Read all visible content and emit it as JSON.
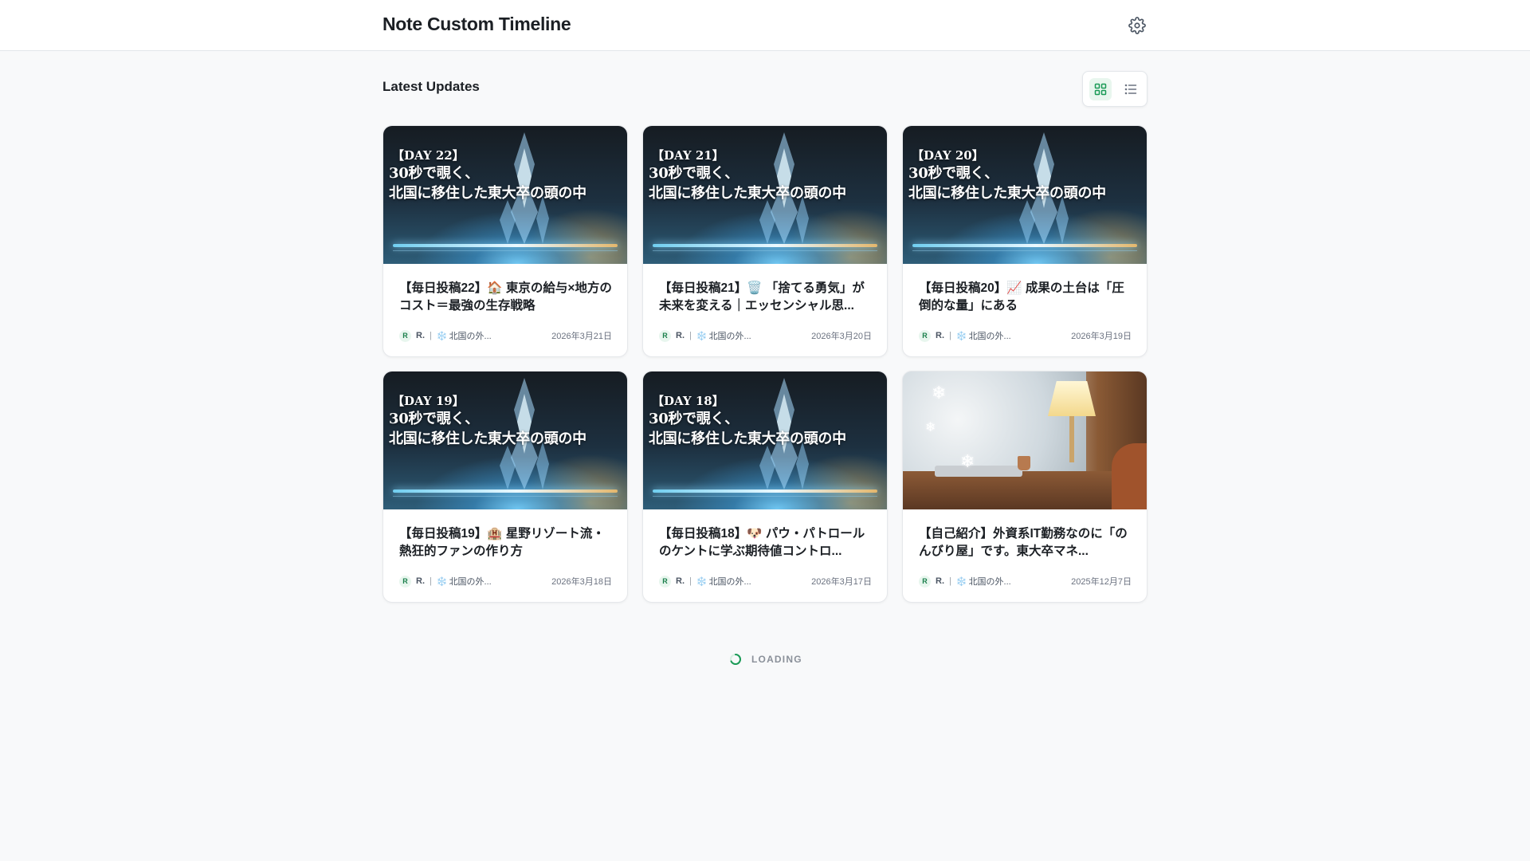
{
  "header": {
    "title": "Note Custom Timeline",
    "settings_icon": "gear-icon"
  },
  "section": {
    "title": "Latest Updates",
    "view_toggle": {
      "active": "grid",
      "grid_icon": "grid-icon",
      "list_icon": "list-icon"
    }
  },
  "colors": {
    "accent": "#1a7f4b",
    "accent_bg": "#e8f6ee",
    "background": "#f8f9fa"
  },
  "cards": [
    {
      "thumb_type": "day",
      "thumb_day": "【DAY 22】",
      "thumb_line1": "30秒で覗く、",
      "thumb_line2": "北国に移住した東大卒の頭の中",
      "title": "【毎日投稿22】🏠 東京の給与×地方のコスト＝最強の生存戦略",
      "avatar": "R",
      "author": "R.",
      "sep": "|",
      "magazine_icon": "❄️",
      "magazine": "北国の外...",
      "date": "2026年3月21日"
    },
    {
      "thumb_type": "day",
      "thumb_day": "【DAY 21】",
      "thumb_line1": "30秒で覗く、",
      "thumb_line2": "北国に移住した東大卒の頭の中",
      "title": "【毎日投稿21】🗑️ 「捨てる勇気」が未来を変える｜エッセンシャル思...",
      "avatar": "R",
      "author": "R.",
      "sep": "|",
      "magazine_icon": "❄️",
      "magazine": "北国の外...",
      "date": "2026年3月20日"
    },
    {
      "thumb_type": "day",
      "thumb_day": "【DAY 20】",
      "thumb_line1": "30秒で覗く、",
      "thumb_line2": "北国に移住した東大卒の頭の中",
      "title": "【毎日投稿20】📈 成果の土台は「圧倒的な量」にある",
      "avatar": "R",
      "author": "R.",
      "sep": "|",
      "magazine_icon": "❄️",
      "magazine": "北国の外...",
      "date": "2026年3月19日"
    },
    {
      "thumb_type": "day",
      "thumb_day": "【DAY 19】",
      "thumb_line1": "30秒で覗く、",
      "thumb_line2": "北国に移住した東大卒の頭の中",
      "title": "【毎日投稿19】🏨 星野リゾート流・熱狂的ファンの作り方",
      "avatar": "R",
      "author": "R.",
      "sep": "|",
      "magazine_icon": "❄️",
      "magazine": "北国の外...",
      "date": "2026年3月18日"
    },
    {
      "thumb_type": "day",
      "thumb_day": "【DAY 18】",
      "thumb_line1": "30秒で覗く、",
      "thumb_line2": "北国に移住した東大卒の頭の中",
      "title": "【毎日投稿18】🐶 パウ・パトロールのケントに学ぶ期待値コントロ...",
      "avatar": "R",
      "author": "R.",
      "sep": "|",
      "magazine_icon": "❄️",
      "magazine": "北国の外...",
      "date": "2026年3月17日"
    },
    {
      "thumb_type": "room",
      "thumb_day": "",
      "thumb_line1": "",
      "thumb_line2": "",
      "title": "【自己紹介】外資系IT勤務なのに「のんびり屋」です。東大卒マネ...",
      "avatar": "R",
      "author": "R.",
      "sep": "|",
      "magazine_icon": "❄️",
      "magazine": "北国の外...",
      "date": "2025年12月7日"
    }
  ],
  "loading": {
    "text": "LOADING",
    "icon": "spinner-icon"
  }
}
